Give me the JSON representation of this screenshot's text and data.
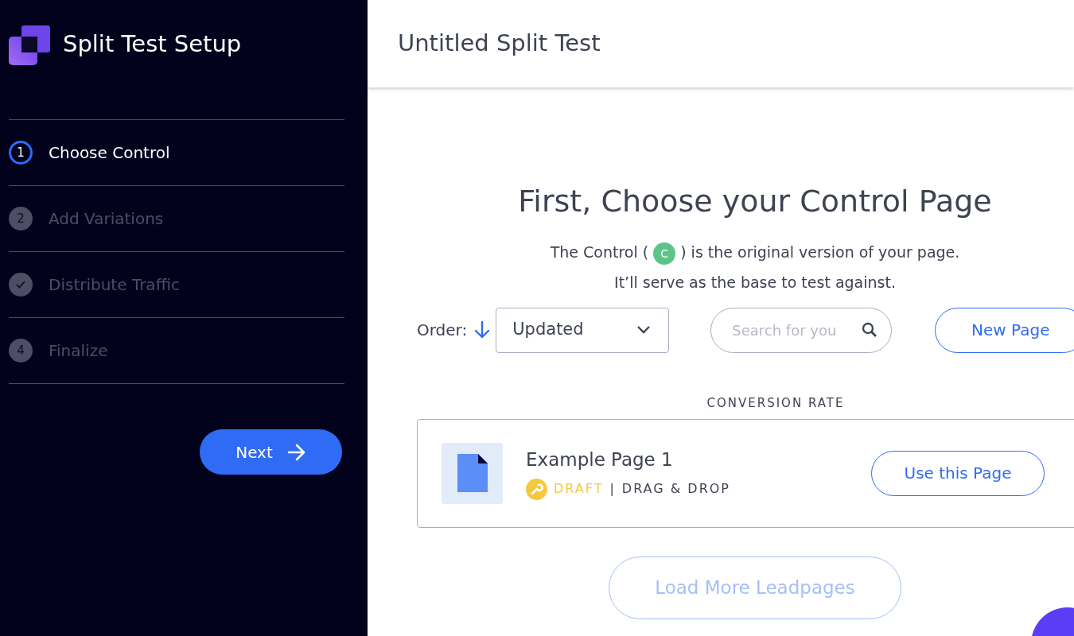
{
  "sidebar": {
    "title": "Split Test Setup",
    "steps": [
      {
        "kind": "number",
        "marker": "1",
        "label": "Choose Control",
        "selected": true
      },
      {
        "kind": "number",
        "marker": "2",
        "label": "Add Variations",
        "selected": false
      },
      {
        "kind": "done",
        "label": "Distribute Traffic",
        "selected": false
      },
      {
        "kind": "number",
        "marker": "4",
        "label": "Finalize",
        "selected": false
      }
    ],
    "next_button": "Next"
  },
  "header": {
    "title": "Untitled Split Test"
  },
  "main": {
    "heading": "First, Choose your Control Page",
    "intro_before": "The Control (",
    "control_badge": "C",
    "intro_after": ") is the original version of your page.",
    "intro_line2": "It’ll serve as the base to test against.",
    "order_label": "Order:",
    "order_value": "Updated",
    "search": {
      "placeholder": "Search for you"
    },
    "new_page_button": "New Page",
    "column_header": "CONVERSION RATE",
    "pages": [
      {
        "name": "Example Page 1",
        "status": "DRAFT",
        "type": "DRAG & DROP",
        "separator": "|",
        "button": "Use this Page"
      }
    ],
    "load_more_button": "Load More Leadpages"
  }
}
